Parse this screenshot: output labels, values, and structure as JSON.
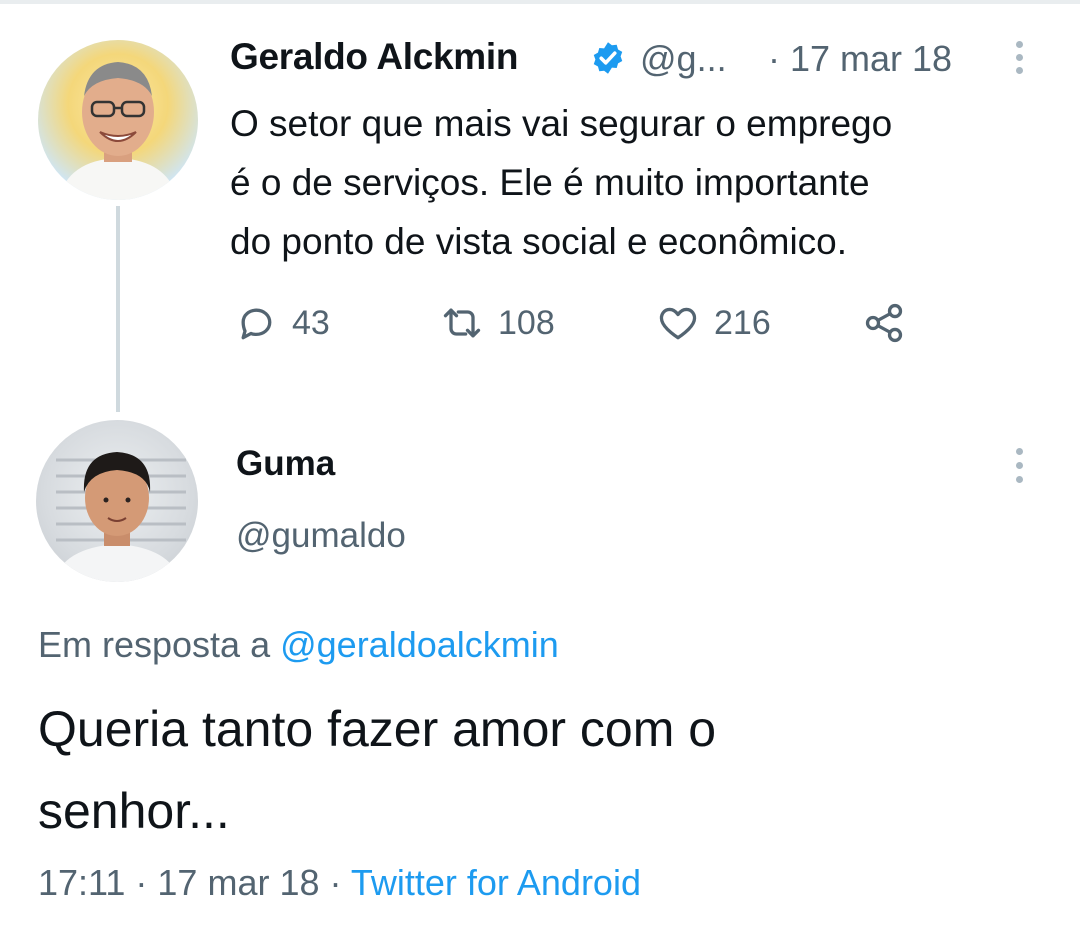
{
  "tweet": {
    "author_name": "Geraldo Alckmin",
    "author_handle": "@g...",
    "date": "· 17 mar 18",
    "body": "O setor que mais vai segurar o emprego\né o de serviços. Ele é muito importante\ndo ponto de vista social e econômico.",
    "replies": "43",
    "retweets": "108",
    "likes": "216",
    "verified": true
  },
  "reply": {
    "author_name": "Guma",
    "author_handle": "@gumaldo",
    "reply_prefix": "Em resposta a ",
    "reply_mention": "@geraldoalckmin",
    "body": "Queria tanto fazer amor com o\nsenhor...",
    "time": "17:11 · 17 mar 18 · ",
    "source": "Twitter for Android"
  },
  "colors": {
    "accent": "#1d9bf0",
    "secondary_text": "#536471",
    "primary_text": "#0f1419"
  },
  "icons": {
    "verified": "verified-badge-icon",
    "more": "more-vertical-icon",
    "reply": "reply-bubble-icon",
    "retweet": "retweet-icon",
    "like": "heart-icon",
    "share": "share-icon"
  }
}
